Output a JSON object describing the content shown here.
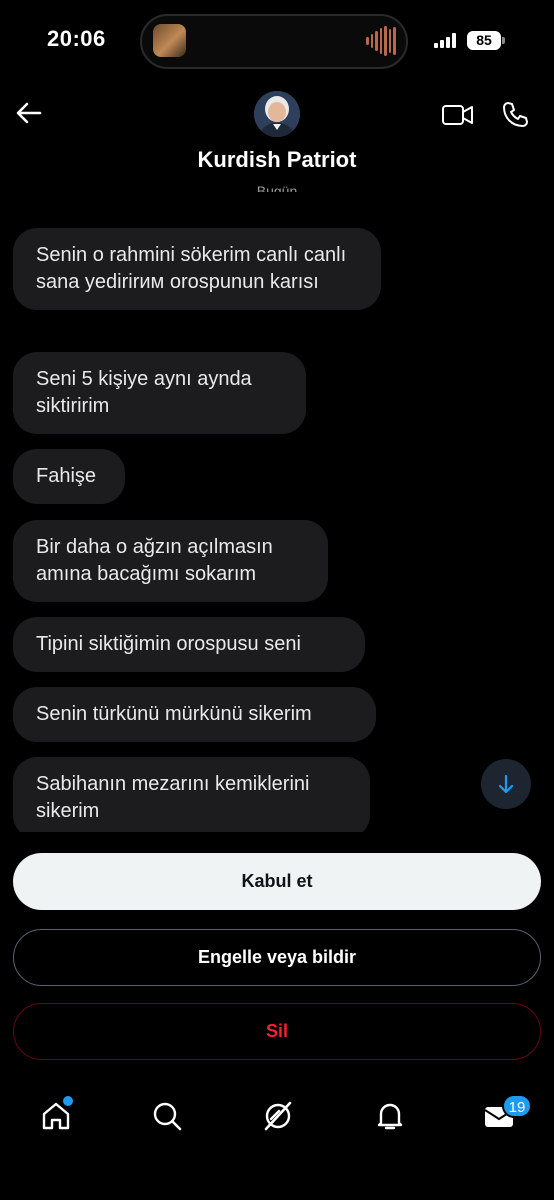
{
  "status_bar": {
    "time": "20:06",
    "battery": "85"
  },
  "header": {
    "back_icon": "arrow-left-icon",
    "contact_name": "Kurdish Patriot",
    "video_icon": "video-call-icon",
    "phone_icon": "phone-icon",
    "date_separator": "Bugün"
  },
  "messages": [
    {
      "text": "Senin o rahmini sökerim canlı canlı  sana yedirirим orospunun karısı"
    },
    {
      "text": "Seni 5 kişiye aynı aynda siktiririm"
    },
    {
      "text": "Fahişe"
    },
    {
      "text": "Bir daha o ağzın açılmasın amına bacağımı sokarım"
    },
    {
      "text": "Tipini siktiğimin orospusu seni"
    },
    {
      "text": "Senin türkünü mürkünü sikerim"
    },
    {
      "text": "Sabihanın mezarını kemiklerini sikerim"
    }
  ],
  "actions": {
    "accept": "Kabul et",
    "block_or_report": "Engelle veya bildir",
    "delete": "Sil"
  },
  "bottom_nav": {
    "items": [
      "home-icon",
      "search-icon",
      "grok-icon",
      "notifications-icon",
      "messages-icon"
    ],
    "messages_badge": "19"
  },
  "colors": {
    "accent": "#1d9bf0",
    "danger": "#f4212e",
    "bubble": "#1c1c1e",
    "background": "#000000"
  }
}
